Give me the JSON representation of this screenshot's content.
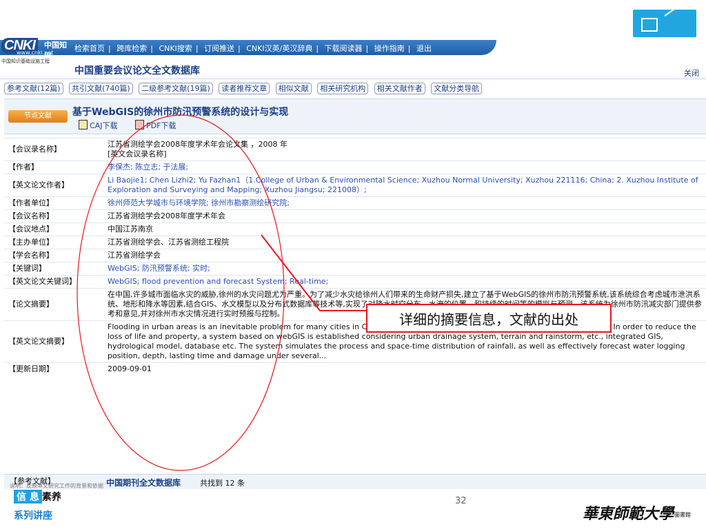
{
  "nav": {
    "logo_text": "CNKI",
    "logo_cn": "中国知网",
    "logo_url": "www.cnki.net",
    "links": [
      "检索首页",
      "跨库检索",
      "CNKI搜索",
      "订阅推送",
      "CNKI汉英/英汉辞典",
      "下载阅读器",
      "操作指南",
      "退出"
    ]
  },
  "header": {
    "project": "中国知识基础设施工程",
    "db_title": "中国重要会议论文全文数据库",
    "close": "关闭"
  },
  "tabs": [
    "参考文献(12篇)",
    "共引文献(740篇)",
    "二级参考文献(19篇)",
    "读者推荐文章",
    "相似文献",
    "相关研究机构",
    "相关文献作者",
    "文献分类导航"
  ],
  "paper": {
    "badge": "节点文献",
    "title": "基于WebGIS的徐州市防汛预警系统的设计与实现",
    "caj": "CAJ下载",
    "pdf": "PDF下载"
  },
  "meta": [
    {
      "k": "【会议录名称】",
      "v": "江苏省测绘学会2008年度学术年会论文集 ，2008 年",
      "v2": "[英文会议录名称]"
    },
    {
      "k": "【作者】",
      "v": "李保杰; 陈立志; 于法展;",
      "link": true
    },
    {
      "k": "【英文论文作者】",
      "v": "Li Baojie1; Chen Lizhi2; Yu Fazhan1（1.College of Urban & Environmental Science; Xuzhou Normal University; Xuzhou 221116; China; 2. Xuzhou Institute of Exploration and Surveying and Mapping; Xuzhou Jiangsu; 221008）;",
      "link": true
    },
    {
      "k": "【作者单位】",
      "v": "徐州师范大学城市与环境学院; 徐州市勘察测绘研究院;",
      "link": true
    },
    {
      "k": "【会议名称】",
      "v": "江苏省测绘学会2008年度学术年会"
    },
    {
      "k": "【会议地点】",
      "v": "中国江苏南京"
    },
    {
      "k": "【主办单位】",
      "v": "江苏省测绘学会、江苏省测绘工程院"
    },
    {
      "k": "【学会名称】",
      "v": "江苏省测绘学会"
    },
    {
      "k": "【关键词】",
      "v": "WebGIS; 防汛预警系统; 实时;",
      "link": true
    },
    {
      "k": "【英文论文关键词】",
      "v": "WebGIS; flood prevention and forecast System; Real-time;",
      "link": true
    },
    {
      "k": "【论文摘要】",
      "v": "在中国,许多城市面临水灾的威胁,徐州的水灾问题尤为严重。为了减少水灾给徐州人们带来的生命财产损失,建立了基于WebGIS的徐州市防汛预警系统,该系统综合考虑城市泄洪系统、地形和降水等因素,结合GIS、水文模型以及分布式数据库等技术等,实现了对降水时空分布、水淹的位置、和持续的时间等的模拟与预测。该系统为徐州市防汛减灾部门提供参考和意见,并对徐州市水灾情况进行实时预报与控制。"
    },
    {
      "k": "【英文论文摘要】",
      "v": "Flooding in urban areas is an inevitable problem for many cities in China. In Xuzhou, has serious problems related to urban flooding. In order to reduce the loss of life and property, a system based on webGIS is established considering urban drainage system, terrain and rainstorm, etc., integrated GIS, hydrological model, database etc. The system simulates the process and space-time distribution of rainfall, as well as effectively forecast water logging position, depth, lasting time and damage under several..."
    },
    {
      "k": "【更新日期】",
      "v": "2009-09-01"
    }
  ],
  "refs": {
    "label": "【参考文献】",
    "sublabel": "说明：反映本文研究工作的背景和依据",
    "db": "中国期刊全文数据库",
    "count": "共找到 12 条"
  },
  "annotation": {
    "text": "详细的摘要信息，文献的出处",
    "color": "#e8161c"
  },
  "footer": {
    "line1a": "信 息",
    "line1b": "素养",
    "line2": "系列讲座",
    "page": "32",
    "university": "華東師範大學",
    "library": "圖書館"
  }
}
